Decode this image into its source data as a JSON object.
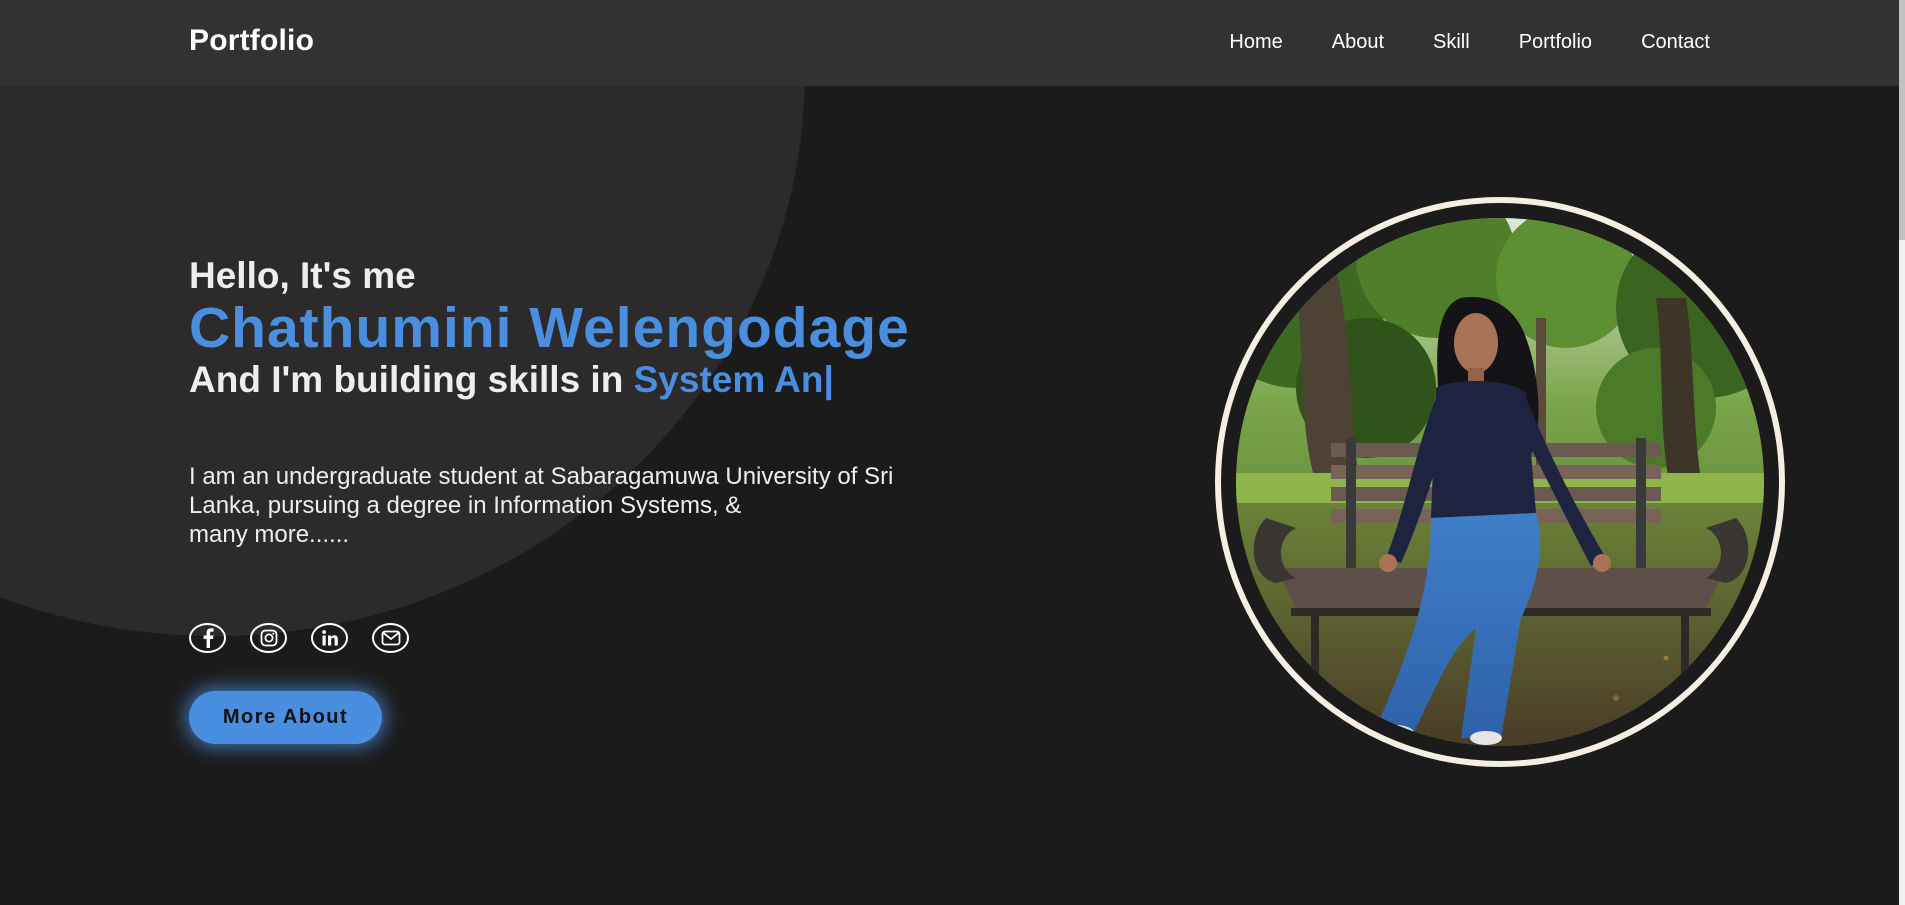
{
  "header": {
    "logo": "Portfolio",
    "nav": [
      "Home",
      "About",
      "Skill",
      "Portfolio",
      "Contact"
    ]
  },
  "hero": {
    "greeting": "Hello, It's me",
    "name": "Chathumini Welengodage",
    "skills_prefix": "And I'm building skills in ",
    "skills_typed": "System An|",
    "intro_lines": [
      "I am an undergraduate student at Sabaragamuwa University of Sri",
      "Lanka, pursuing a degree in Information Systems, &",
      "many more......"
    ],
    "socials": [
      "facebook-icon",
      "instagram-icon",
      "linkedin-icon",
      "mail-icon"
    ],
    "button_label": "More About"
  },
  "colors": {
    "background": "#1c1b1b",
    "header": "#343131",
    "accent": "#4a8ee0",
    "ring": "#f4efe2"
  }
}
